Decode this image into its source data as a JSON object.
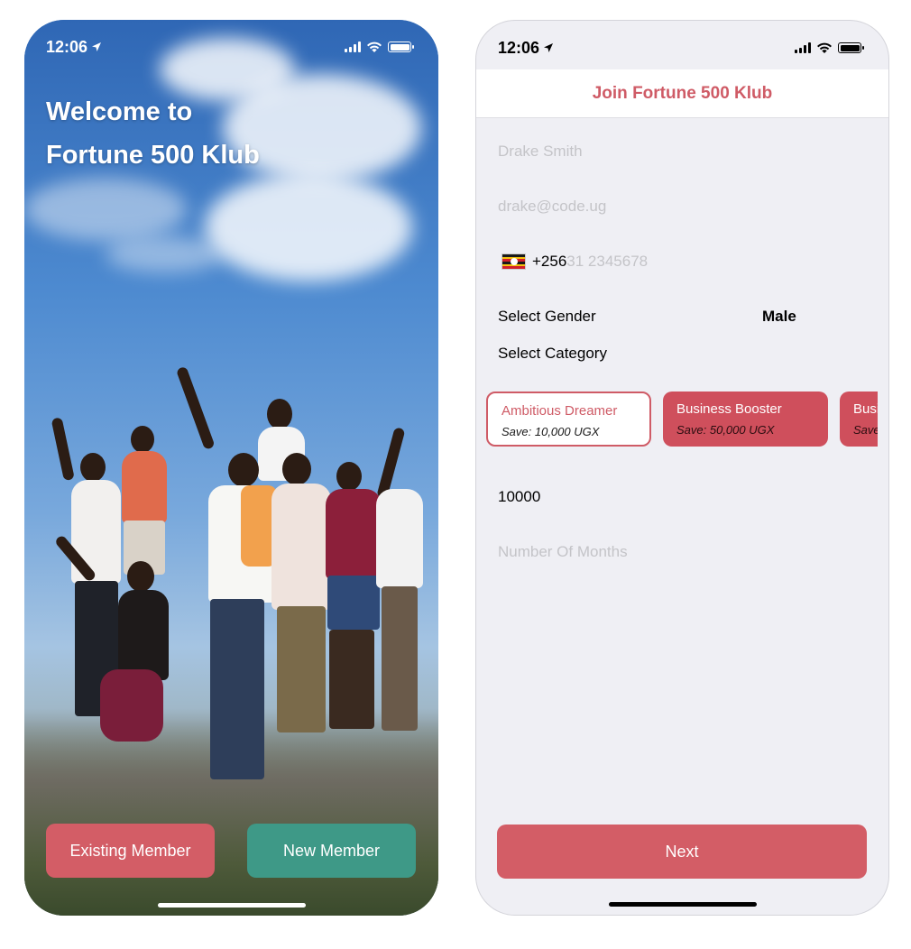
{
  "welcome_screen": {
    "status": {
      "time": "12:06"
    },
    "title_line1": "Welcome to",
    "title_line2": "Fortune 500 Klub",
    "existing_member_label": "Existing Member",
    "new_member_label": "New Member"
  },
  "join_screen": {
    "status": {
      "time": "12:06"
    },
    "nav_title": "Join Fortune 500 Klub",
    "name_placeholder": "Drake Smith",
    "email_placeholder": "drake@code.ug",
    "phone_code": "+256",
    "phone_placeholder": "31 2345678",
    "gender_label": "Select Gender",
    "gender_value": "Male",
    "category_label": "Select Category",
    "categories": [
      {
        "name": "Ambitious Dreamer",
        "save": "Save: 10,000 UGX"
      },
      {
        "name": "Business Booster",
        "save": "Save: 50,000 UGX"
      },
      {
        "name": "Business",
        "save": "Save"
      }
    ],
    "amount_value": "10000",
    "months_placeholder": "Number Of Months",
    "next_label": "Next"
  },
  "colors": {
    "accent_red": "#d35d66",
    "accent_green": "#3e9987",
    "title_red": "#cf5b66"
  },
  "icons": [
    "location-arrow-icon",
    "signal-icon",
    "wifi-icon",
    "battery-icon",
    "uganda-flag-icon"
  ]
}
